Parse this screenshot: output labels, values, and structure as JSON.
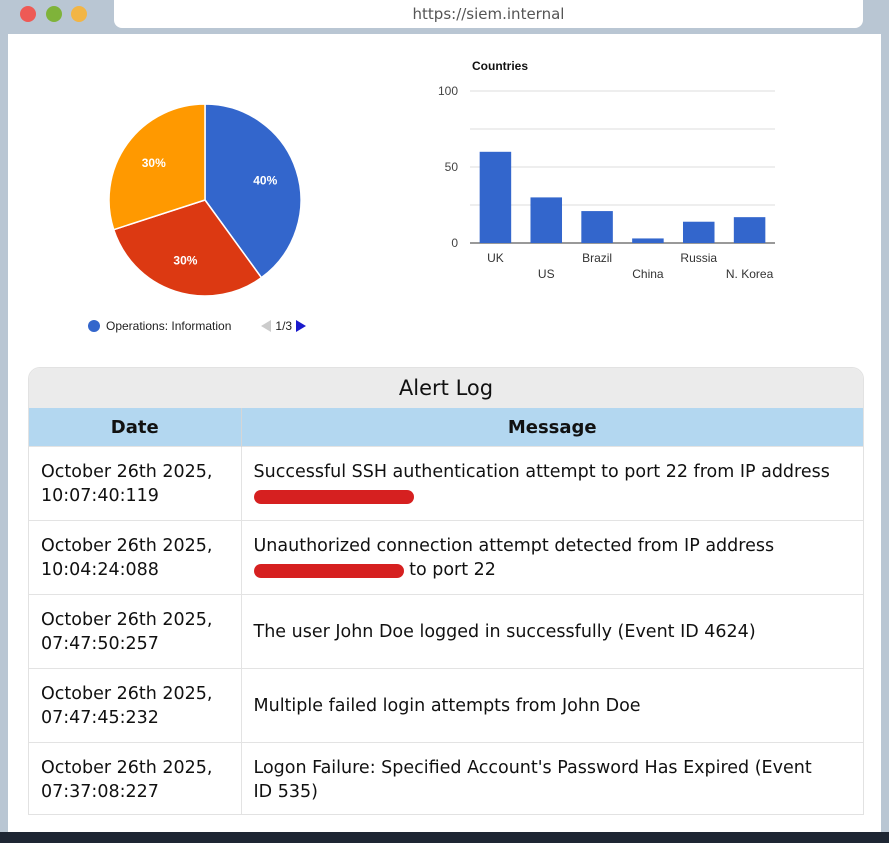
{
  "browser": {
    "url": "https://siem.internal"
  },
  "pie": {
    "slices": [
      {
        "label": "40%",
        "value": 40,
        "color": "#3366cc"
      },
      {
        "label": "30%",
        "value": 30,
        "color": "#dc3912"
      },
      {
        "label": "30%",
        "value": 30,
        "color": "#ff9900"
      }
    ],
    "legend_label": "Operations: Information",
    "pager_text": "1/3"
  },
  "chart_data": {
    "type": "bar",
    "title": "Countries",
    "categories": [
      "UK",
      "US",
      "Brazil",
      "China",
      "Russia",
      "N. Korea"
    ],
    "values": [
      60,
      30,
      21,
      3,
      14,
      17
    ],
    "ylim": [
      0,
      100
    ],
    "yticks": [
      0,
      50,
      100
    ],
    "color": "#3366cc",
    "grid": true
  },
  "alert_log": {
    "title": "Alert Log",
    "columns": [
      "Date",
      "Message"
    ],
    "rows": [
      {
        "date_line1": "October 26th 2025,",
        "date_line2": "10:07:40:119",
        "msg_line1": "Successful SSH authentication attempt to port 22 from IP address",
        "msg_line2_after": ""
      },
      {
        "date_line1": "October 26th 2025,",
        "date_line2": "10:04:24:088",
        "msg_line1": "Unauthorized connection attempt detected from IP address",
        "msg_line2_after": "to port 22"
      },
      {
        "date_line1": "October 26th 2025,",
        "date_line2": "07:47:50:257",
        "msg_line1": "The user John Doe logged in successfully (Event ID 4624)"
      },
      {
        "date_line1": "October 26th 2025,",
        "date_line2": "07:47:45:232",
        "msg_line1": "Multiple failed login attempts from John Doe"
      },
      {
        "date_line1": "October 26th 2025,",
        "date_line2": "07:37:08:227",
        "msg_line1": "Logon Failure: Specified Account's Password Has Expired (Event",
        "msg_line2_after": "ID 535)"
      }
    ]
  }
}
